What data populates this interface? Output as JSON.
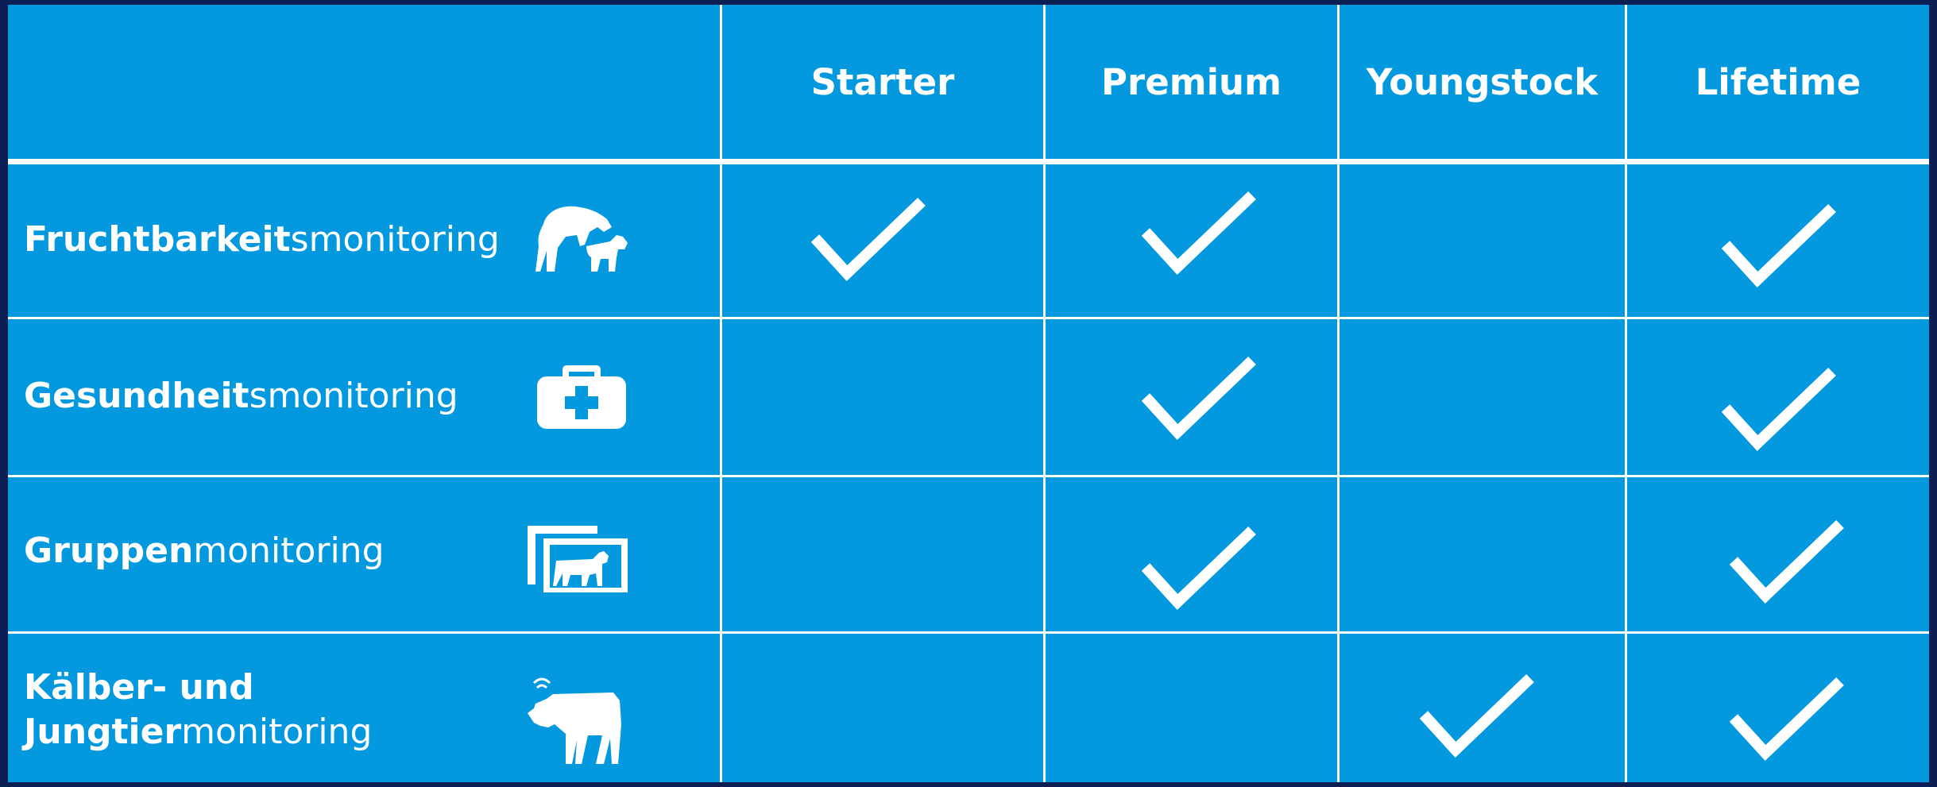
{
  "columns": [
    "Starter",
    "Premium",
    "Youngstock",
    "Lifetime"
  ],
  "rows": [
    {
      "bold": "Fruchtbarkeit",
      "normal": "smonitoring",
      "icon": "cow-mounting-icon",
      "checks": [
        true,
        true,
        false,
        true
      ]
    },
    {
      "bold": "Gesundheit",
      "normal": "smonitoring",
      "icon": "medical-bag-icon",
      "checks": [
        false,
        true,
        false,
        true
      ]
    },
    {
      "bold": "Gruppen",
      "normal": "monitoring",
      "icon": "cow-group-icon",
      "checks": [
        false,
        true,
        false,
        true
      ]
    },
    {
      "bold_line1": "Kälber- und",
      "bold": "Jungtier",
      "normal": "monitoring",
      "icon": "calf-sensor-icon",
      "checks": [
        false,
        false,
        true,
        true
      ]
    }
  ],
  "colors": {
    "background": "#0499de",
    "border": "#0b1f55",
    "lines": "#ffffff"
  }
}
